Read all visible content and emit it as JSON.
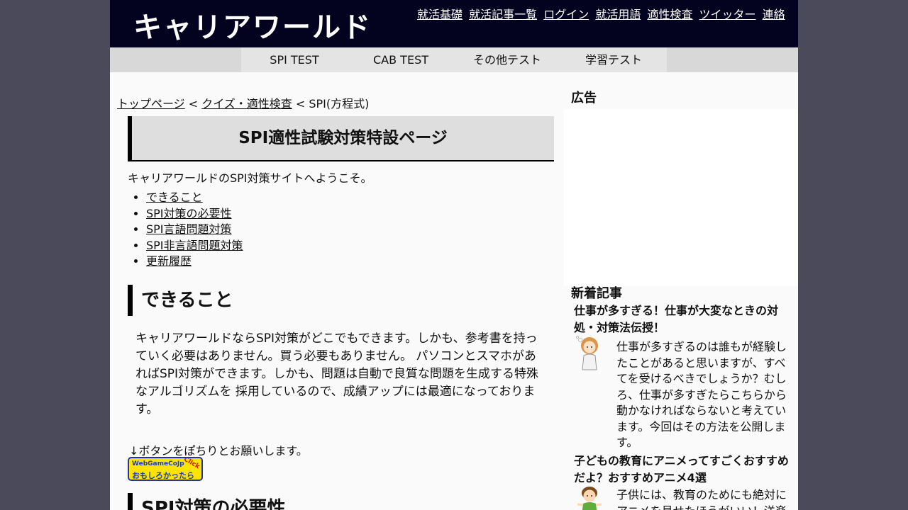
{
  "header": {
    "logo": "キャリアワールド",
    "links": [
      "就活基礎",
      "就活記事一覧",
      "ログイン",
      "就活用語",
      "適性検査",
      "ツイッター",
      "連絡"
    ]
  },
  "nav": [
    "SPI TEST",
    "CAB TEST",
    "その他テスト",
    "学習テスト"
  ],
  "breadcrumb": {
    "home": "トップページ",
    "sep1": " < ",
    "category": "クイズ・適性検査",
    "sep2": " < ",
    "current": "SPI(方程式)"
  },
  "main": {
    "special_title": "SPI適性試験対策特設ページ",
    "welcome": "キャリアワールドのSPI対策サイトへようこそ。",
    "toc": [
      "できること",
      "SPI対策の必要性",
      "SPI言語問題対策",
      "SPI非言語問題対策",
      "更新履歴"
    ],
    "section1_heading": "できること",
    "section1_text": "キャリアワールドならSPI対策がどこでもできます。しかも、参考書を持っていく必要はありません。買う必要もありません。 パソコンとスマホがあればSPI対策ができます。しかも、問題は自動で良質な問題を生成する特殊なアルゴリズムを 採用しているので、成績アップには最適になっております。",
    "request_text": "↓ボタンをぽちりとお願いします。",
    "banner": {
      "line1": "WebGameCoJp",
      "line2": "おもしろかったら",
      "corner": "Click"
    },
    "section2_heading": "SPI対策の必要性"
  },
  "sidebar": {
    "ad_heading": "広告",
    "new_heading": "新着記事",
    "articles": [
      {
        "title": "仕事が多すぎる！仕事が大変なときの対処・対策法伝授！",
        "text": "仕事が多すぎるのは誰もが経験したことがあると思いますが、すべてを受けるべきでしょうか？むしろ、仕事が多すぎたらこちらから動かなければならないと考えています。今回はその方法を公開します。"
      },
      {
        "title": "子どもの教育にアニメってすごくおすすめだよ？おすすめアニメ4選",
        "text": "子供には、教育のためにも絶対にアニメを見せたほうがいい！洋楽"
      }
    ]
  },
  "colors": {
    "header_bg": "#030320",
    "page_bg": "#4a4a5a",
    "nav_bg": "#d8d8d8",
    "title_box_bg": "#dedede",
    "banner_yellow": "#ffe400"
  },
  "icons": [
    "woman-thinking-illustration",
    "child-illustration"
  ]
}
